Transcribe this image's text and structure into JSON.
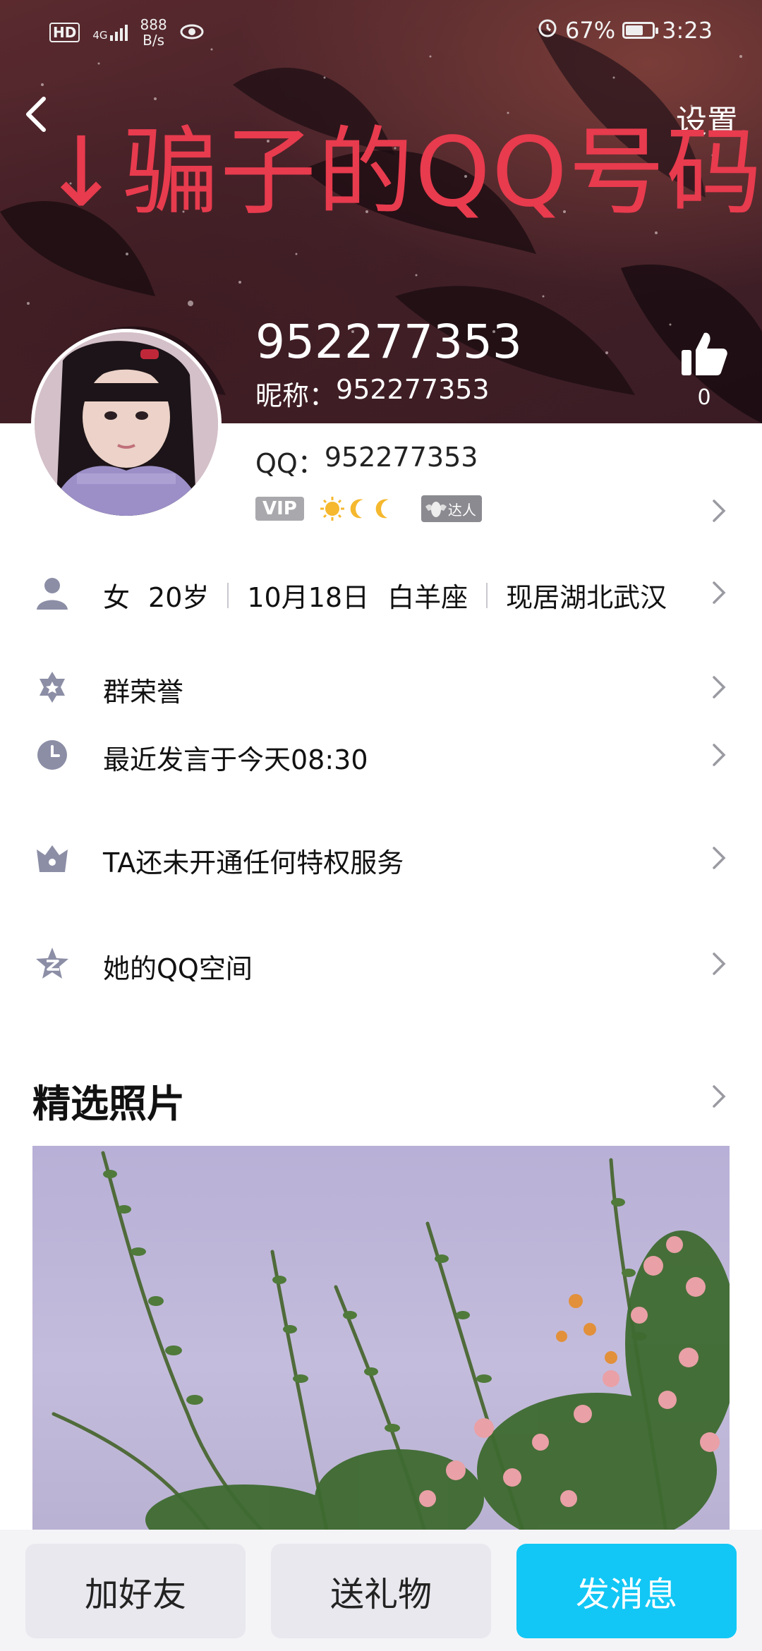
{
  "status_bar": {
    "hd": "HD",
    "network": "4G",
    "speed_top": "888",
    "speed_bottom": "B/s",
    "battery": "67%",
    "battery_level": 0.67,
    "time": "3:23"
  },
  "header": {
    "settings_label": "设置",
    "warning_text": "↓骗子的QQ号码",
    "uin": "952277353",
    "nickname_label": "昵称：",
    "nickname_value": "952277353",
    "like_count": "0",
    "warning_color": "#e83b4e"
  },
  "profile": {
    "qq_label": "QQ：",
    "qq_value": "952277353",
    "vip_badge": "VIP",
    "daren_badge": "达人"
  },
  "info": {
    "gender": "女",
    "age": "20岁",
    "birthday": "10月18日",
    "zodiac": "白羊座",
    "location": "现居湖北武汉"
  },
  "rows": {
    "group_honor": "群荣誉",
    "last_speech": "最近发言于今天08:30",
    "privilege": "TA还未开通任何特权服务",
    "qzone": "她的QQ空间"
  },
  "photos": {
    "title": "精选照片"
  },
  "actions": {
    "add_friend": "加好友",
    "send_gift": "送礼物",
    "send_message": "发消息",
    "accent": "#12c7f5"
  }
}
